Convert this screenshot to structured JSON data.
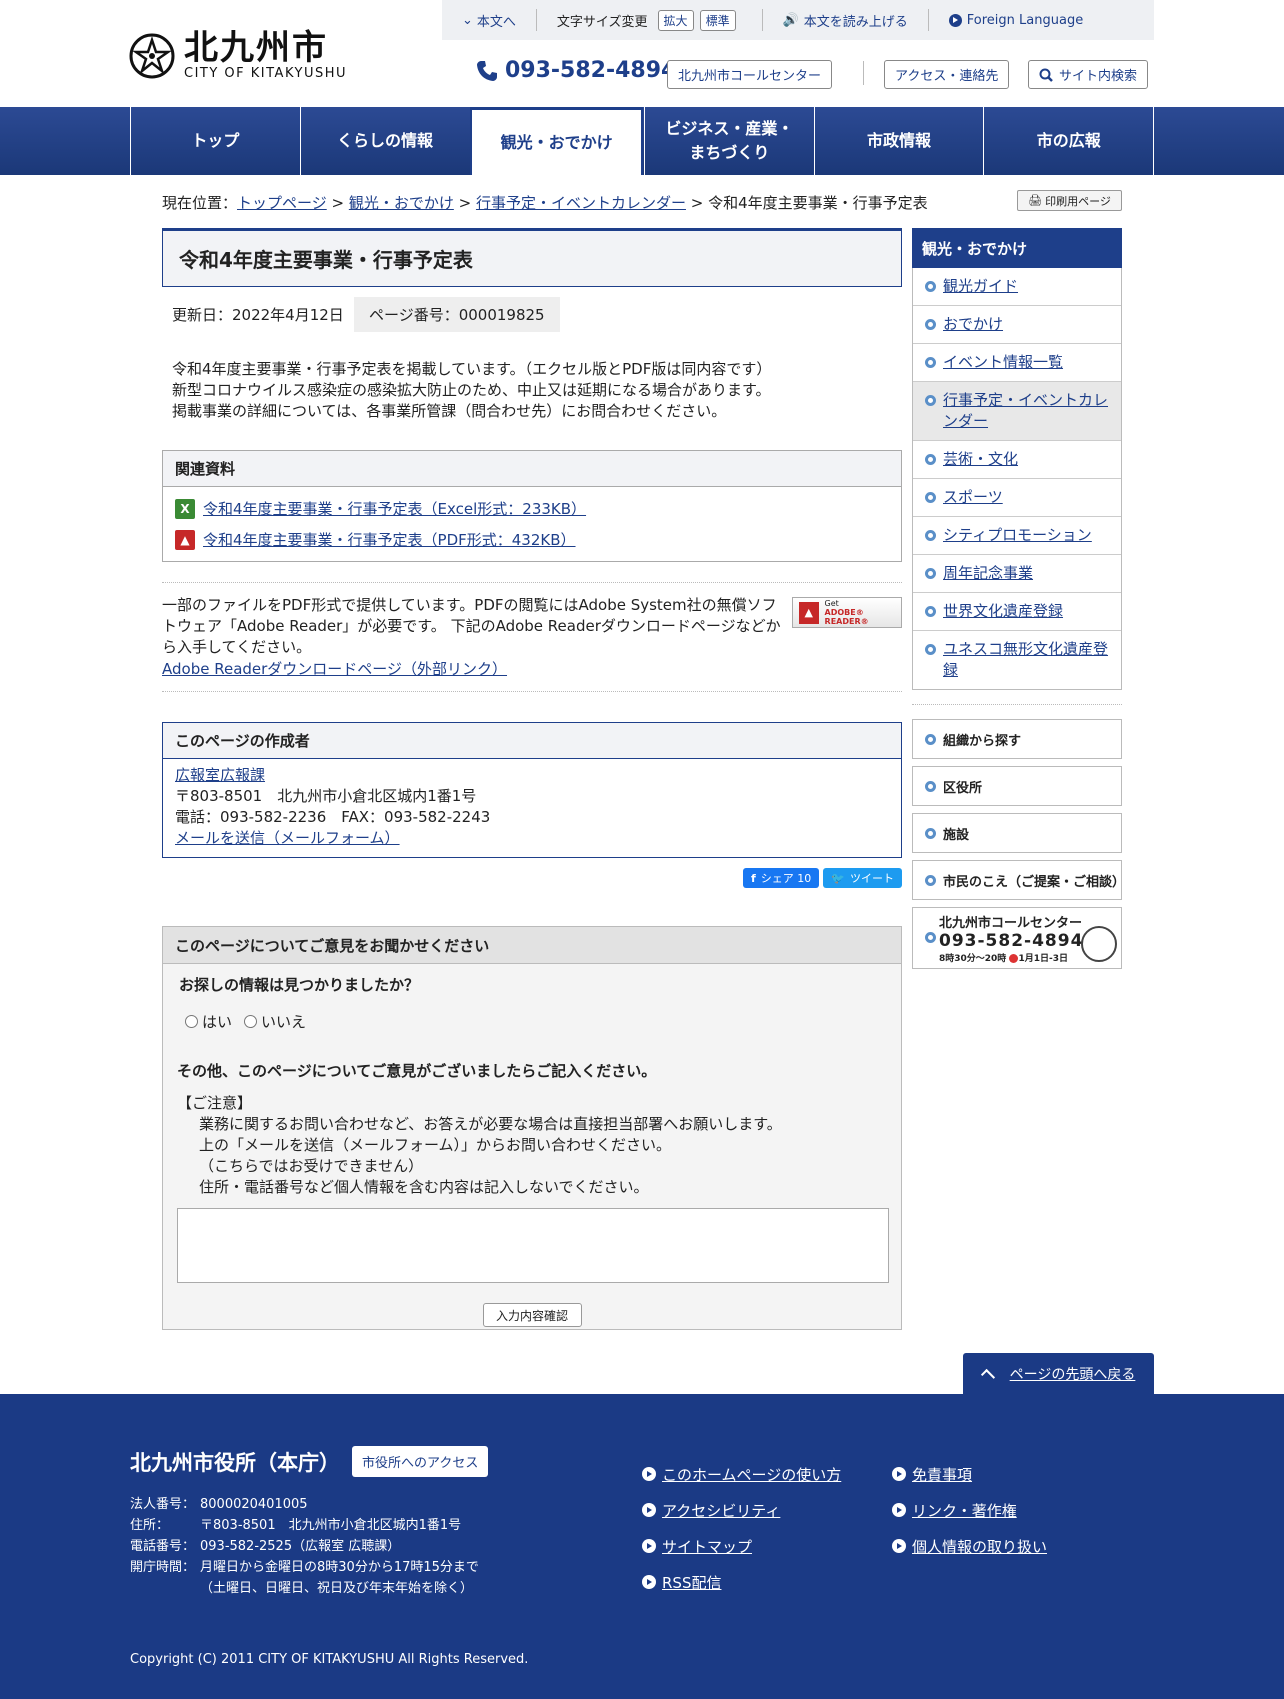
{
  "header": {
    "logo_jp": "北九州市",
    "logo_en": "CITY OF KITAKYUSHU",
    "skip_link": "本文へ",
    "text_size_label": "文字サイズ変更",
    "size_large": "拡大",
    "size_standard": "標準",
    "read_aloud": "本文を読み上げる",
    "foreign_language": "Foreign Language",
    "phone": "093-582-4894",
    "call_center": "北九州市コールセンター",
    "access": "アクセス・連絡先",
    "site_search": "サイト内検索"
  },
  "nav": {
    "items": [
      {
        "label": "トップ"
      },
      {
        "label": "くらしの情報"
      },
      {
        "label": "観光・おでかけ"
      },
      {
        "label": "ビジネス・産業・\nまちづくり"
      },
      {
        "label": "市政情報"
      },
      {
        "label": "市の広報"
      }
    ]
  },
  "breadcrumb": {
    "prefix": "現在位置：",
    "items": [
      "トップページ",
      "観光・おでかけ",
      "行事予定・イベントカレンダー"
    ],
    "current": "令和4年度主要事業・行事予定表",
    "sep": " > "
  },
  "print_button": "印刷用ページ",
  "page": {
    "title": "令和4年度主要事業・行事予定表",
    "updated": "更新日：2022年4月12日",
    "page_number": "ページ番号：000019825",
    "intro": [
      "令和4年度主要事業・行事予定表を掲載しています。（エクセル版とPDF版は同内容です）",
      "新型コロナウイルス感染症の感染拡大防止のため、中止又は延期になる場合があります。",
      "掲載事業の詳細については、各事業所管課（問合わせ先）にお問合わせください。"
    ]
  },
  "related": {
    "heading": "関連資料",
    "files": [
      {
        "label": "令和4年度主要事業・行事予定表（Excel形式：233KB）",
        "icon": "excel-file-icon"
      },
      {
        "label": "令和4年度主要事業・行事予定表（PDF形式：432KB）",
        "icon": "pdf-file-icon"
      }
    ]
  },
  "adobe": {
    "text": "一部のファイルをPDF形式で提供しています。PDFの閲覧にはAdobe System社の無償ソフトウェア「Adobe Reader」が必要です。 下記のAdobe Readerダウンロードページなどから入手してください。",
    "link": "Adobe Readerダウンロードページ（外部リンク）",
    "badge_get": "Get",
    "badge_reader": "ADOBE® READER®"
  },
  "creator": {
    "heading": "このページの作成者",
    "dept": "広報室広報課",
    "address": "〒803-8501　北九州市小倉北区城内1番1号",
    "phone": "電話：093-582-2236　FAX：093-582-2243",
    "mail": "メールを送信（メールフォーム）"
  },
  "share": {
    "fb": "シェア 10",
    "tw": "ツイート"
  },
  "feedback": {
    "heading": "このページについてご意見をお聞かせください",
    "q1": "お探しの情報は見つかりましたか？",
    "yes": "はい",
    "no": "いいえ",
    "q2": "その他、このページについてご意見がございましたらご記入ください。",
    "notice_title": "【ご注意】",
    "notice": [
      "業務に関するお問い合わせなど、お答えが必要な場合は直接担当部署へお願いします。",
      "上の「メールを送信（メールフォーム）」からお問い合わせください。",
      "（こちらではお受けできません）",
      "住所・電話番号など個人情報を含む内容は記入しないでください。"
    ],
    "confirm": "入力内容確認"
  },
  "sidebar": {
    "heading": "観光・おでかけ",
    "items": [
      {
        "label": "観光ガイド"
      },
      {
        "label": "おでかけ"
      },
      {
        "label": "イベント情報一覧"
      },
      {
        "label": "行事予定・イベントカレンダー"
      },
      {
        "label": "芸術・文化"
      },
      {
        "label": "スポーツ"
      },
      {
        "label": "シティプロモーション"
      },
      {
        "label": "周年記念事業"
      },
      {
        "label": "世界文化遺産登録"
      },
      {
        "label": "ユネスコ無形文化遺産登録"
      }
    ],
    "buttons": [
      "組織から探す",
      "区役所",
      "施設",
      "市民のこえ（ご提案・ご相談）"
    ],
    "callcenter_title": "北九州市コールセンター",
    "callcenter_phone": "093-582-4894",
    "callcenter_hours": "8時30分～20時",
    "callcenter_closed": "1月1日-3日"
  },
  "to_top": "ページの先頭へ戻る",
  "footer": {
    "title": "北九州市役所（本庁）",
    "access_btn": "市役所へのアクセス",
    "info": [
      {
        "label": "法人番号：",
        "value": "8000020401005"
      },
      {
        "label": "住所：",
        "value": "〒803-8501　北九州市小倉北区城内1番1号"
      },
      {
        "label": "電話番号：",
        "value": "093-582-2525（広報室 広聴課）"
      },
      {
        "label": "開庁時間：",
        "value": "月曜日から金曜日の8時30分から17時15分まで"
      },
      {
        "label": "",
        "value": "（土曜日、日曜日、祝日及び年末年始を除く）"
      }
    ],
    "links_col1": [
      "このホームページの使い方",
      "アクセシビリティ",
      "サイトマップ",
      "RSS配信"
    ],
    "links_col2": [
      "免責事項",
      "リンク・著作権",
      "個人情報の取り扱い"
    ],
    "copyright": "Copyright (C) 2011 CITY OF KITAKYUSHU All Rights Reserved."
  }
}
